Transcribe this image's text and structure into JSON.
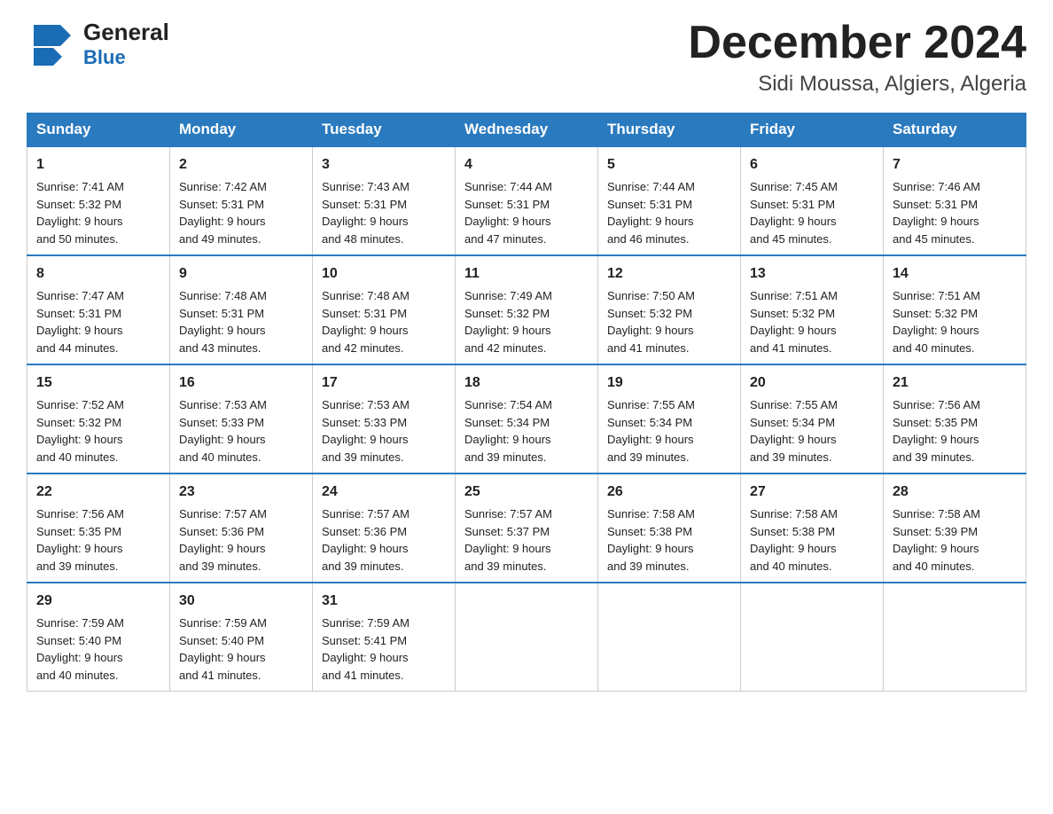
{
  "header": {
    "logo_general": "General",
    "logo_blue": "Blue",
    "month_title": "December 2024",
    "location": "Sidi Moussa, Algiers, Algeria"
  },
  "days_of_week": [
    "Sunday",
    "Monday",
    "Tuesday",
    "Wednesday",
    "Thursday",
    "Friday",
    "Saturday"
  ],
  "weeks": [
    [
      {
        "day": "1",
        "sunrise": "7:41 AM",
        "sunset": "5:32 PM",
        "daylight": "9 hours and 50 minutes."
      },
      {
        "day": "2",
        "sunrise": "7:42 AM",
        "sunset": "5:31 PM",
        "daylight": "9 hours and 49 minutes."
      },
      {
        "day": "3",
        "sunrise": "7:43 AM",
        "sunset": "5:31 PM",
        "daylight": "9 hours and 48 minutes."
      },
      {
        "day": "4",
        "sunrise": "7:44 AM",
        "sunset": "5:31 PM",
        "daylight": "9 hours and 47 minutes."
      },
      {
        "day": "5",
        "sunrise": "7:44 AM",
        "sunset": "5:31 PM",
        "daylight": "9 hours and 46 minutes."
      },
      {
        "day": "6",
        "sunrise": "7:45 AM",
        "sunset": "5:31 PM",
        "daylight": "9 hours and 45 minutes."
      },
      {
        "day": "7",
        "sunrise": "7:46 AM",
        "sunset": "5:31 PM",
        "daylight": "9 hours and 45 minutes."
      }
    ],
    [
      {
        "day": "8",
        "sunrise": "7:47 AM",
        "sunset": "5:31 PM",
        "daylight": "9 hours and 44 minutes."
      },
      {
        "day": "9",
        "sunrise": "7:48 AM",
        "sunset": "5:31 PM",
        "daylight": "9 hours and 43 minutes."
      },
      {
        "day": "10",
        "sunrise": "7:48 AM",
        "sunset": "5:31 PM",
        "daylight": "9 hours and 42 minutes."
      },
      {
        "day": "11",
        "sunrise": "7:49 AM",
        "sunset": "5:32 PM",
        "daylight": "9 hours and 42 minutes."
      },
      {
        "day": "12",
        "sunrise": "7:50 AM",
        "sunset": "5:32 PM",
        "daylight": "9 hours and 41 minutes."
      },
      {
        "day": "13",
        "sunrise": "7:51 AM",
        "sunset": "5:32 PM",
        "daylight": "9 hours and 41 minutes."
      },
      {
        "day": "14",
        "sunrise": "7:51 AM",
        "sunset": "5:32 PM",
        "daylight": "9 hours and 40 minutes."
      }
    ],
    [
      {
        "day": "15",
        "sunrise": "7:52 AM",
        "sunset": "5:32 PM",
        "daylight": "9 hours and 40 minutes."
      },
      {
        "day": "16",
        "sunrise": "7:53 AM",
        "sunset": "5:33 PM",
        "daylight": "9 hours and 40 minutes."
      },
      {
        "day": "17",
        "sunrise": "7:53 AM",
        "sunset": "5:33 PM",
        "daylight": "9 hours and 39 minutes."
      },
      {
        "day": "18",
        "sunrise": "7:54 AM",
        "sunset": "5:34 PM",
        "daylight": "9 hours and 39 minutes."
      },
      {
        "day": "19",
        "sunrise": "7:55 AM",
        "sunset": "5:34 PM",
        "daylight": "9 hours and 39 minutes."
      },
      {
        "day": "20",
        "sunrise": "7:55 AM",
        "sunset": "5:34 PM",
        "daylight": "9 hours and 39 minutes."
      },
      {
        "day": "21",
        "sunrise": "7:56 AM",
        "sunset": "5:35 PM",
        "daylight": "9 hours and 39 minutes."
      }
    ],
    [
      {
        "day": "22",
        "sunrise": "7:56 AM",
        "sunset": "5:35 PM",
        "daylight": "9 hours and 39 minutes."
      },
      {
        "day": "23",
        "sunrise": "7:57 AM",
        "sunset": "5:36 PM",
        "daylight": "9 hours and 39 minutes."
      },
      {
        "day": "24",
        "sunrise": "7:57 AM",
        "sunset": "5:36 PM",
        "daylight": "9 hours and 39 minutes."
      },
      {
        "day": "25",
        "sunrise": "7:57 AM",
        "sunset": "5:37 PM",
        "daylight": "9 hours and 39 minutes."
      },
      {
        "day": "26",
        "sunrise": "7:58 AM",
        "sunset": "5:38 PM",
        "daylight": "9 hours and 39 minutes."
      },
      {
        "day": "27",
        "sunrise": "7:58 AM",
        "sunset": "5:38 PM",
        "daylight": "9 hours and 40 minutes."
      },
      {
        "day": "28",
        "sunrise": "7:58 AM",
        "sunset": "5:39 PM",
        "daylight": "9 hours and 40 minutes."
      }
    ],
    [
      {
        "day": "29",
        "sunrise": "7:59 AM",
        "sunset": "5:40 PM",
        "daylight": "9 hours and 40 minutes."
      },
      {
        "day": "30",
        "sunrise": "7:59 AM",
        "sunset": "5:40 PM",
        "daylight": "9 hours and 41 minutes."
      },
      {
        "day": "31",
        "sunrise": "7:59 AM",
        "sunset": "5:41 PM",
        "daylight": "9 hours and 41 minutes."
      },
      null,
      null,
      null,
      null
    ]
  ],
  "labels": {
    "sunrise": "Sunrise:",
    "sunset": "Sunset:",
    "daylight": "Daylight:"
  },
  "colors": {
    "header_bg": "#2a7abf",
    "border_top": "#2a7abf"
  }
}
